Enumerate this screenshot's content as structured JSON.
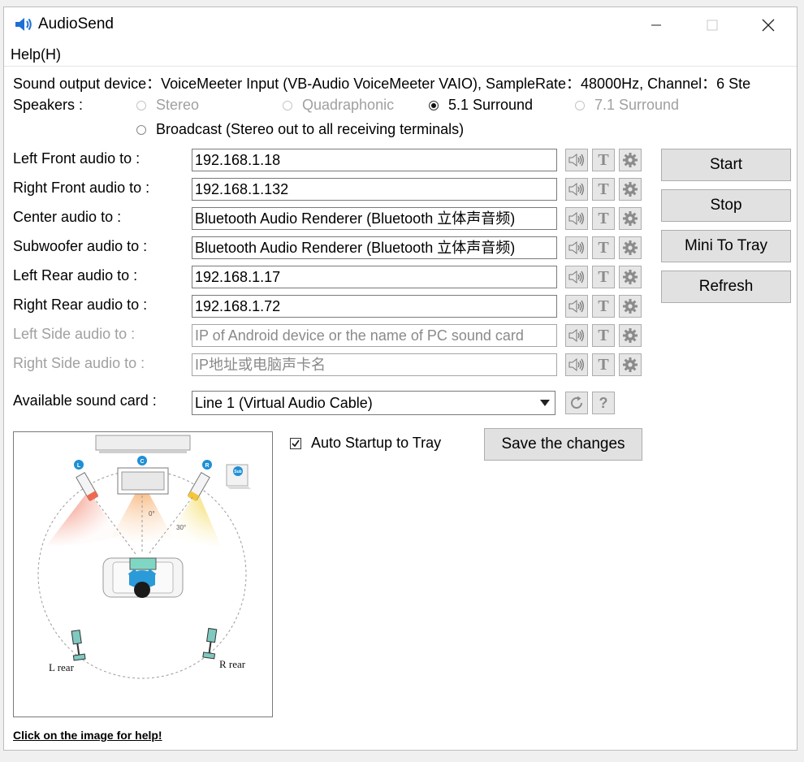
{
  "window": {
    "title": "AudioSend",
    "icon": "speaker-icon",
    "controls": [
      "minimize-icon",
      "maximize-icon",
      "close-icon"
    ]
  },
  "menu": {
    "help": "Help(H)"
  },
  "device_info": "Sound output device：VoiceMeeter Input (VB-Audio VoiceMeeter VAIO), SampleRate：48000Hz, Channel：6  Ste",
  "speakers": {
    "label": "Speakers :",
    "options": [
      {
        "label": "Stereo",
        "state": "disabled"
      },
      {
        "label": "Quadraphonic",
        "state": "disabled"
      },
      {
        "label": "5.1 Surround",
        "state": "checked"
      },
      {
        "label": "7.1 Surround",
        "state": "disabled"
      },
      {
        "label": "Broadcast (Stereo out to all receiving terminals)",
        "state": "enabled"
      }
    ]
  },
  "channels": [
    {
      "label": "Left Front audio to :",
      "value": "192.168.1.18",
      "enabled": true
    },
    {
      "label": "Right Front audio to :",
      "value": "192.168.1.132",
      "enabled": true
    },
    {
      "label": "Center audio to :",
      "value": "Bluetooth Audio Renderer (Bluetooth 立体声音频)",
      "enabled": true
    },
    {
      "label": "Subwoofer audio to :",
      "value": "Bluetooth Audio Renderer (Bluetooth 立体声音频)",
      "enabled": true
    },
    {
      "label": "Left Rear audio to :",
      "value": "192.168.1.17",
      "enabled": true
    },
    {
      "label": "Right Rear audio to :",
      "value": "192.168.1.72",
      "enabled": true
    },
    {
      "label": "Left Side audio to :",
      "placeholder": "IP of Android device or the name of PC sound card",
      "enabled": false
    },
    {
      "label": "Right Side audio to :",
      "placeholder": "IP地址或电脑声卡名",
      "enabled": false
    }
  ],
  "channel_buttons": {
    "test_icon": "speaker-test-icon",
    "text_label": "T",
    "settings_icon": "gear-icon"
  },
  "buttons": {
    "start": "Start",
    "stop": "Stop",
    "mini_to_tray": "Mini To Tray",
    "refresh": "Refresh",
    "save": "Save the changes"
  },
  "available_sound_card": {
    "label": "Available sound card :",
    "selected": "Line 1 (Virtual Audio Cable)",
    "refresh_icon": "refresh-icon",
    "help_label": "?"
  },
  "auto_startup": {
    "label": "Auto Startup to Tray",
    "checked": true
  },
  "diagram": {
    "labels": {
      "left": "L",
      "center": "C",
      "right": "R",
      "sub": "Sub",
      "zero_deg": "0°",
      "thirty_deg": "30°",
      "left_rear": "L rear",
      "right_rear": "R rear"
    }
  },
  "help_link": "Click on the image for help!"
}
